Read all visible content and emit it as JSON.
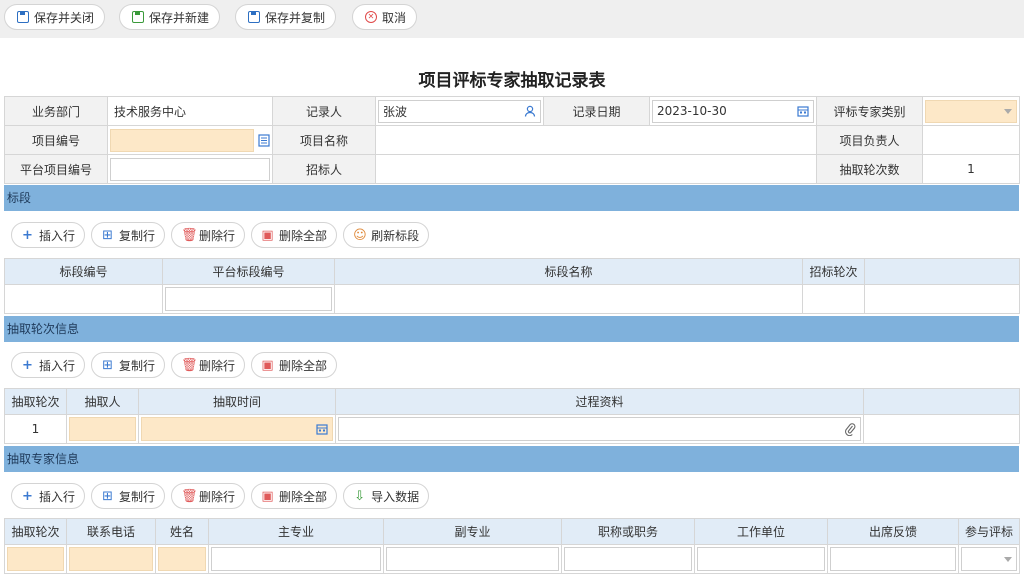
{
  "toolbar": {
    "save_close": "保存并关闭",
    "save_new": "保存并新建",
    "save_copy": "保存并复制",
    "cancel": "取消"
  },
  "title": "项目评标专家抽取记录表",
  "form": {
    "dept_label": "业务部门",
    "dept_value": "技术服务中心",
    "recorder_label": "记录人",
    "recorder_value": "张波",
    "date_label": "记录日期",
    "date_value": "2023-10-30",
    "expert_type_label": "评标专家类别",
    "project_no_label": "项目编号",
    "project_name_label": "项目名称",
    "project_owner_label": "项目负责人",
    "platform_no_label": "平台项目编号",
    "tenderer_label": "招标人",
    "rounds_label": "抽取轮次数",
    "rounds_value": "1"
  },
  "section_lots": {
    "title": "标段",
    "buttons": {
      "insert": "插入行",
      "copy": "复制行",
      "delete": "删除行",
      "delete_all": "删除全部",
      "refresh": "刷新标段"
    },
    "columns": [
      "标段编号",
      "平台标段编号",
      "标段名称",
      "招标轮次",
      ""
    ]
  },
  "section_rounds": {
    "title": "抽取轮次信息",
    "buttons": {
      "insert": "插入行",
      "copy": "复制行",
      "delete": "删除行",
      "delete_all": "删除全部"
    },
    "columns": [
      "抽取轮次",
      "抽取人",
      "抽取时间",
      "过程资料",
      ""
    ],
    "row": {
      "round": "1"
    }
  },
  "section_experts": {
    "title": "抽取专家信息",
    "buttons": {
      "insert": "插入行",
      "copy": "复制行",
      "delete": "删除行",
      "delete_all": "删除全部",
      "import": "导入数据"
    },
    "columns": [
      "抽取轮次",
      "联系电话",
      "姓名",
      "主专业",
      "副专业",
      "职称或职务",
      "工作单位",
      "出席反馈",
      "参与评标"
    ]
  }
}
